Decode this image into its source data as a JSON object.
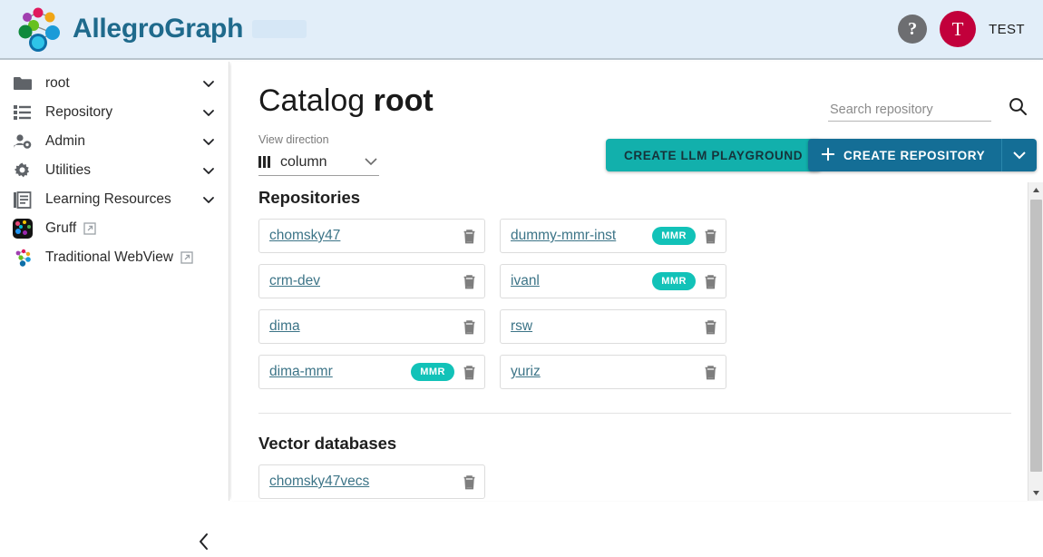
{
  "header": {
    "brand_name": "AllegroGraph",
    "logo_icon": "graph-nodes-logo",
    "help_icon": "?",
    "avatar_initial": "T",
    "user_label": "TEST",
    "background_color": "#e2eef9",
    "brand_color": "#1f6a8c",
    "avatar_color": "#c2003b"
  },
  "sidebar": {
    "items": [
      {
        "label": "root",
        "icon": "folder-icon",
        "has_caret": true,
        "external": false
      },
      {
        "label": "Repository",
        "icon": "list-icon",
        "has_caret": true,
        "external": false
      },
      {
        "label": "Admin",
        "icon": "user-gear-icon",
        "has_caret": true,
        "external": false
      },
      {
        "label": "Utilities",
        "icon": "gear-icon",
        "has_caret": true,
        "external": false
      },
      {
        "label": "Learning Resources",
        "icon": "book-icon",
        "has_caret": true,
        "external": false
      },
      {
        "label": "Gruff",
        "icon": "gruff-app-icon",
        "has_caret": false,
        "external": true
      },
      {
        "label": "Traditional WebView",
        "icon": "webview-graph-icon",
        "has_caret": false,
        "external": true
      }
    ],
    "collapse_icon": "chevron-left-icon"
  },
  "main": {
    "title_prefix": "Catalog ",
    "title_name": "root",
    "view_direction": {
      "label": "View direction",
      "value": "column",
      "icon": "column-bars-icon",
      "caret_icon": "chevron-down-icon"
    },
    "search": {
      "placeholder": "Search repository",
      "value": "",
      "icon": "search-icon"
    },
    "buttons": {
      "llm_playground": "CREATE LLM PLAYGROUND",
      "llm_playground_color": "#12b0ac",
      "create_repository": "CREATE REPOSITORY",
      "create_repository_color": "#146e96",
      "plus_icon": "plus-icon",
      "dropdown_icon": "chevron-down-icon"
    },
    "sections": [
      {
        "title": "Repositories",
        "items": [
          {
            "name": "chomsky47",
            "badge": "",
            "delete_icon": "trash-icon"
          },
          {
            "name": "dummy-mmr-inst",
            "badge": "MMR",
            "delete_icon": "trash-icon"
          },
          {
            "name": "crm-dev",
            "badge": "",
            "delete_icon": "trash-icon"
          },
          {
            "name": "ivanl",
            "badge": "MMR",
            "delete_icon": "trash-icon"
          },
          {
            "name": "dima",
            "badge": "",
            "delete_icon": "trash-icon"
          },
          {
            "name": "rsw",
            "badge": "",
            "delete_icon": "trash-icon"
          },
          {
            "name": "dima-mmr",
            "badge": "MMR",
            "delete_icon": "trash-icon"
          },
          {
            "name": "yuriz",
            "badge": "",
            "delete_icon": "trash-icon"
          }
        ]
      },
      {
        "title": "Vector databases",
        "items": [
          {
            "name": "chomsky47vecs",
            "badge": "",
            "delete_icon": "trash-icon"
          }
        ]
      }
    ],
    "badge_color": "#12c2b8",
    "link_color": "#3c7487"
  },
  "scrollbar": {
    "up_icon": "caret-up-icon",
    "down_icon": "caret-down-icon"
  }
}
